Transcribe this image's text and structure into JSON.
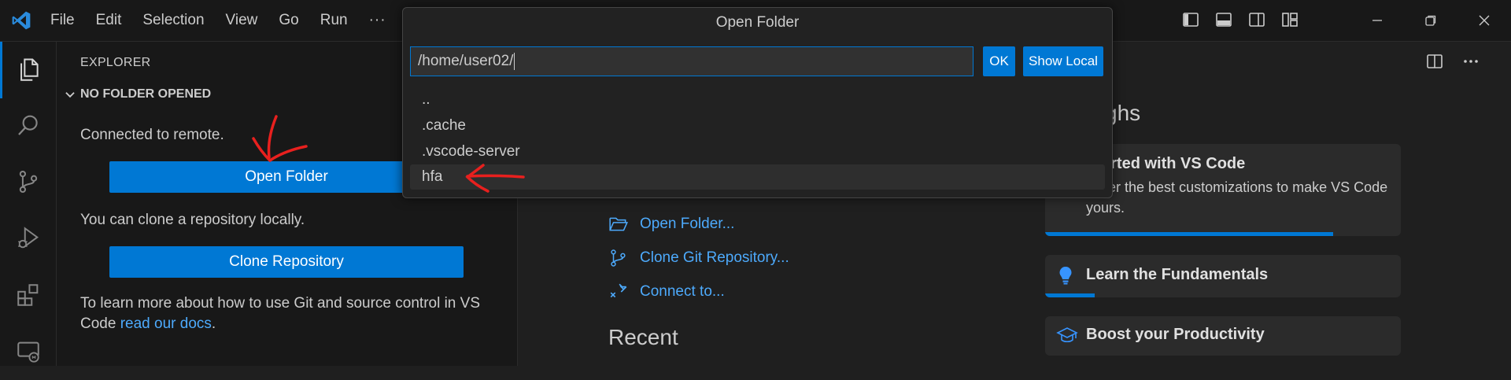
{
  "menu": {
    "file": "File",
    "edit": "Edit",
    "selection": "Selection",
    "view": "View",
    "go": "Go",
    "run": "Run",
    "more": "···"
  },
  "sidebar": {
    "title": "EXPLORER",
    "section": "NO FOLDER OPENED",
    "connected_text": "Connected to remote.",
    "open_folder_button": "Open Folder",
    "clone_text": "You can clone a repository locally.",
    "clone_button": "Clone Repository",
    "learn_text": "To learn more about how to use Git and source control in VS Code ",
    "learn_link": "read our docs",
    "learn_end": "."
  },
  "dialog": {
    "title": "Open Folder",
    "input_value": "/home/user02/",
    "ok_button": "OK",
    "show_local_button": "Show Local",
    "items": [
      "..",
      ".cache",
      ".vscode-server",
      "hfa"
    ],
    "selected_index": 3
  },
  "welcome": {
    "start_items": [
      "Open Folder...",
      "Clone Git Repository...",
      "Connect to..."
    ],
    "recent_heading": "Recent",
    "walkthroughs_heading": "nroughs",
    "cards": [
      {
        "title": "Started with VS Code",
        "desc": "cover the best customizations to make VS Code yours.",
        "progress": 0.81
      },
      {
        "title": "Learn the Fundamentals",
        "desc": "",
        "progress": 0.14
      },
      {
        "title": "Boost your Productivity",
        "desc": "",
        "progress": 0
      }
    ]
  },
  "colors": {
    "accent": "#0078d4",
    "link": "#4daafc",
    "annotation": "#e8201e"
  },
  "icons": [
    "vscode-logo-icon",
    "explorer-icon",
    "search-icon",
    "source-control-icon",
    "run-debug-icon",
    "extensions-icon",
    "remote-explorer-icon",
    "layout-icons",
    "window-controls"
  ]
}
